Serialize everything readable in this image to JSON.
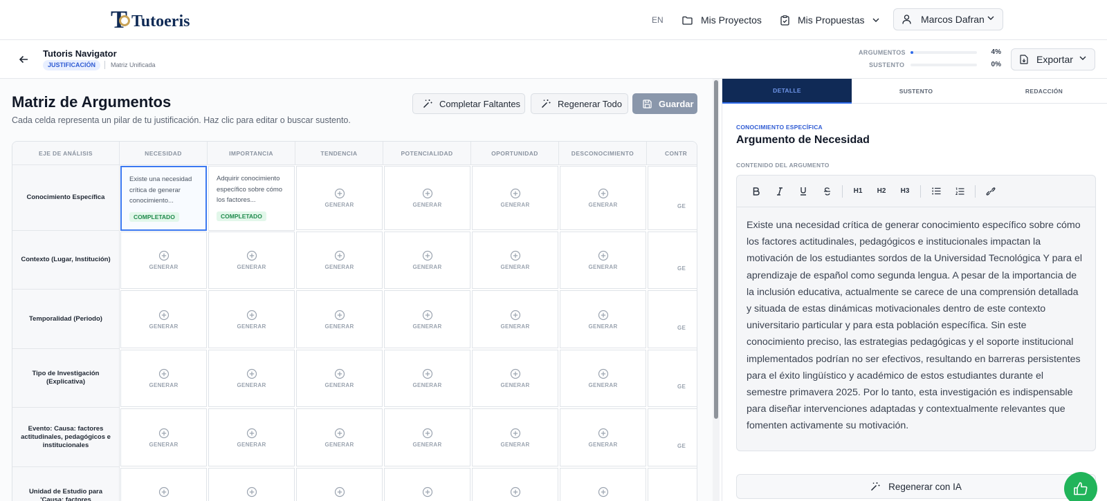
{
  "topnav": {
    "brand": "Tutoeris",
    "lang": "EN",
    "projects_label": "Mis Proyectos",
    "proposals_label": "Mis Propuestas",
    "user_name": "Marcos Dafran"
  },
  "subheader": {
    "title": "Tutoris Navigator",
    "badge": "JUSTIFICACIÓN",
    "context": "Matriz Unificada",
    "progress": [
      {
        "label": "ARGUMENTOS",
        "value_text": "4%",
        "value": 4
      },
      {
        "label": "SUSTENTO",
        "value_text": "0%",
        "value": 0
      }
    ],
    "export_label": "Exportar"
  },
  "matrix": {
    "title": "Matriz de Argumentos",
    "subtitle": "Cada celda representa un pilar de tu justificación. Haz clic para editar o buscar sustento.",
    "btn_fill_missing": "Completar Faltantes",
    "btn_regen_all": "Regenerar Todo",
    "btn_save": "Guardar",
    "axis_header": "EJE DE ANÁLISIS",
    "columns": [
      "NECESIDAD",
      "IMPORTANCIA",
      "TENDENCIA",
      "POTENCIALIDAD",
      "OPORTUNIDAD",
      "DESCONOCIMIENTO",
      "CONTR"
    ],
    "rows": [
      "Conocimiento Específica",
      "Contexto (Lugar, Institución)",
      "Temporalidad (Periodo)",
      "Tipo de Investigación (Explicativa)",
      "Evento: Causa: factores actitudinales, pedagógicos e institucionales",
      "Unidad de Estudio para 'Causa: factores"
    ],
    "generate_label": "GENERAR",
    "generate_label_cut": "GE",
    "completed_label": "COMPLETADO",
    "filled": {
      "r0c0": "Existe una necesidad crítica de generar conocimiento...",
      "r0c1": "Adquirir conocimiento específico sobre cómo los factores..."
    }
  },
  "detail": {
    "tabs": [
      "DETALLE",
      "SUSTENTO",
      "REDACCIÓN"
    ],
    "kicker": "CONOCIMIENTO ESPECÍFICA",
    "title": "Argumento de Necesidad",
    "content_label": "CONTENIDO DEL ARGUMENTO",
    "toolbar": [
      "B",
      "I",
      "U",
      "S",
      "H1",
      "H2",
      "H3"
    ],
    "content": "Existe una necesidad crítica de generar conocimiento específico sobre cómo los factores actitudinales, pedagógicos e institucionales impactan la motivación de los estudiantes sordos de la Universidad Tecnológica Y para el aprendizaje de español como segunda lengua. A pesar de la importancia de la inclusión educativa, actualmente se carece de una comprensión detallada y situada de estas dinámicas motivacionales dentro de este contexto universitario particular y para esta población específica. Sin este conocimiento preciso, las estrategias pedagógicas y el soporte institucional implementados podrían no ser efectivos, resultando en barreras persistentes para el éxito lingüístico y académico de estos estudiantes durante el semestre primavera 2025. Por lo tanto, esta investigación es indispensable para diseñar intervenciones adaptadas y contextualmente relevantes que fomenten activamente su motivación.",
    "regen_label": "Regenerar con IA"
  },
  "colors": {
    "navy": "#102a56",
    "accent": "#2f6bea",
    "success": "#21b45a"
  }
}
